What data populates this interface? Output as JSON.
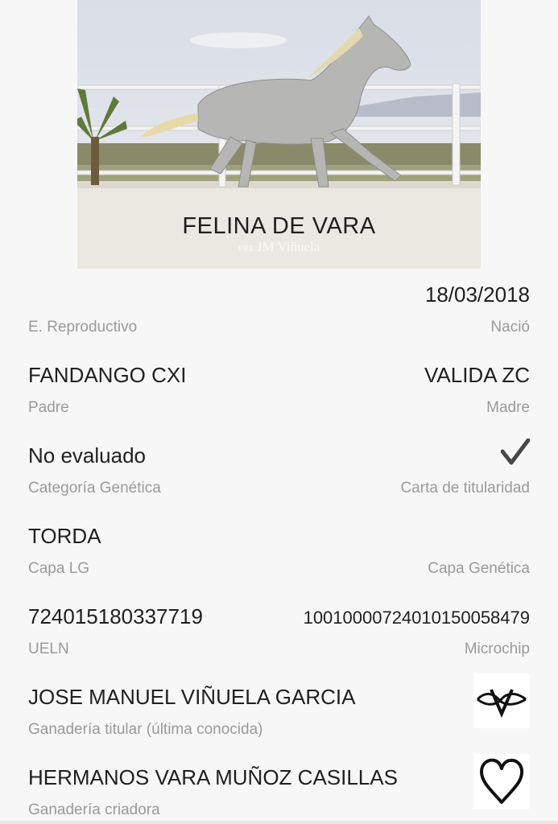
{
  "horse": {
    "name": "FELINA DE VARA",
    "watermark_prefix": "PRE",
    "watermark": "JM Viñuela"
  },
  "fields": {
    "reproductive": {
      "value": "",
      "label": "E. Reproductivo"
    },
    "birth": {
      "value": "18/03/2018",
      "label": "Nació"
    },
    "father": {
      "value": "FANDANGO CXI",
      "label": "Padre"
    },
    "mother": {
      "value": "VALIDA ZC",
      "label": "Madre"
    },
    "genetic_category": {
      "value": "No evaluado",
      "label": "Categoría Genética"
    },
    "ownership_card": {
      "icon": "checkmark-icon",
      "label": "Carta de titularidad"
    },
    "coat_lg": {
      "value": "TORDA",
      "label": "Capa LG"
    },
    "coat_genetic": {
      "value": "",
      "label": "Capa Genética"
    },
    "ueln": {
      "value": "724015180337719",
      "label": "UELN"
    },
    "microchip": {
      "value": "100100007240101500584​79",
      "label": "Microchip"
    },
    "owner_stud": {
      "value": "JOSE MANUEL VIÑUELA GARCIA",
      "label": "Ganadería titular (última conocida)",
      "icon": "brand-mark-icon"
    },
    "breeder_stud": {
      "value": "HERMANOS VARA MUÑOZ CASILLAS",
      "label": "Ganadería criadora",
      "icon": "heart-brand-icon"
    }
  }
}
